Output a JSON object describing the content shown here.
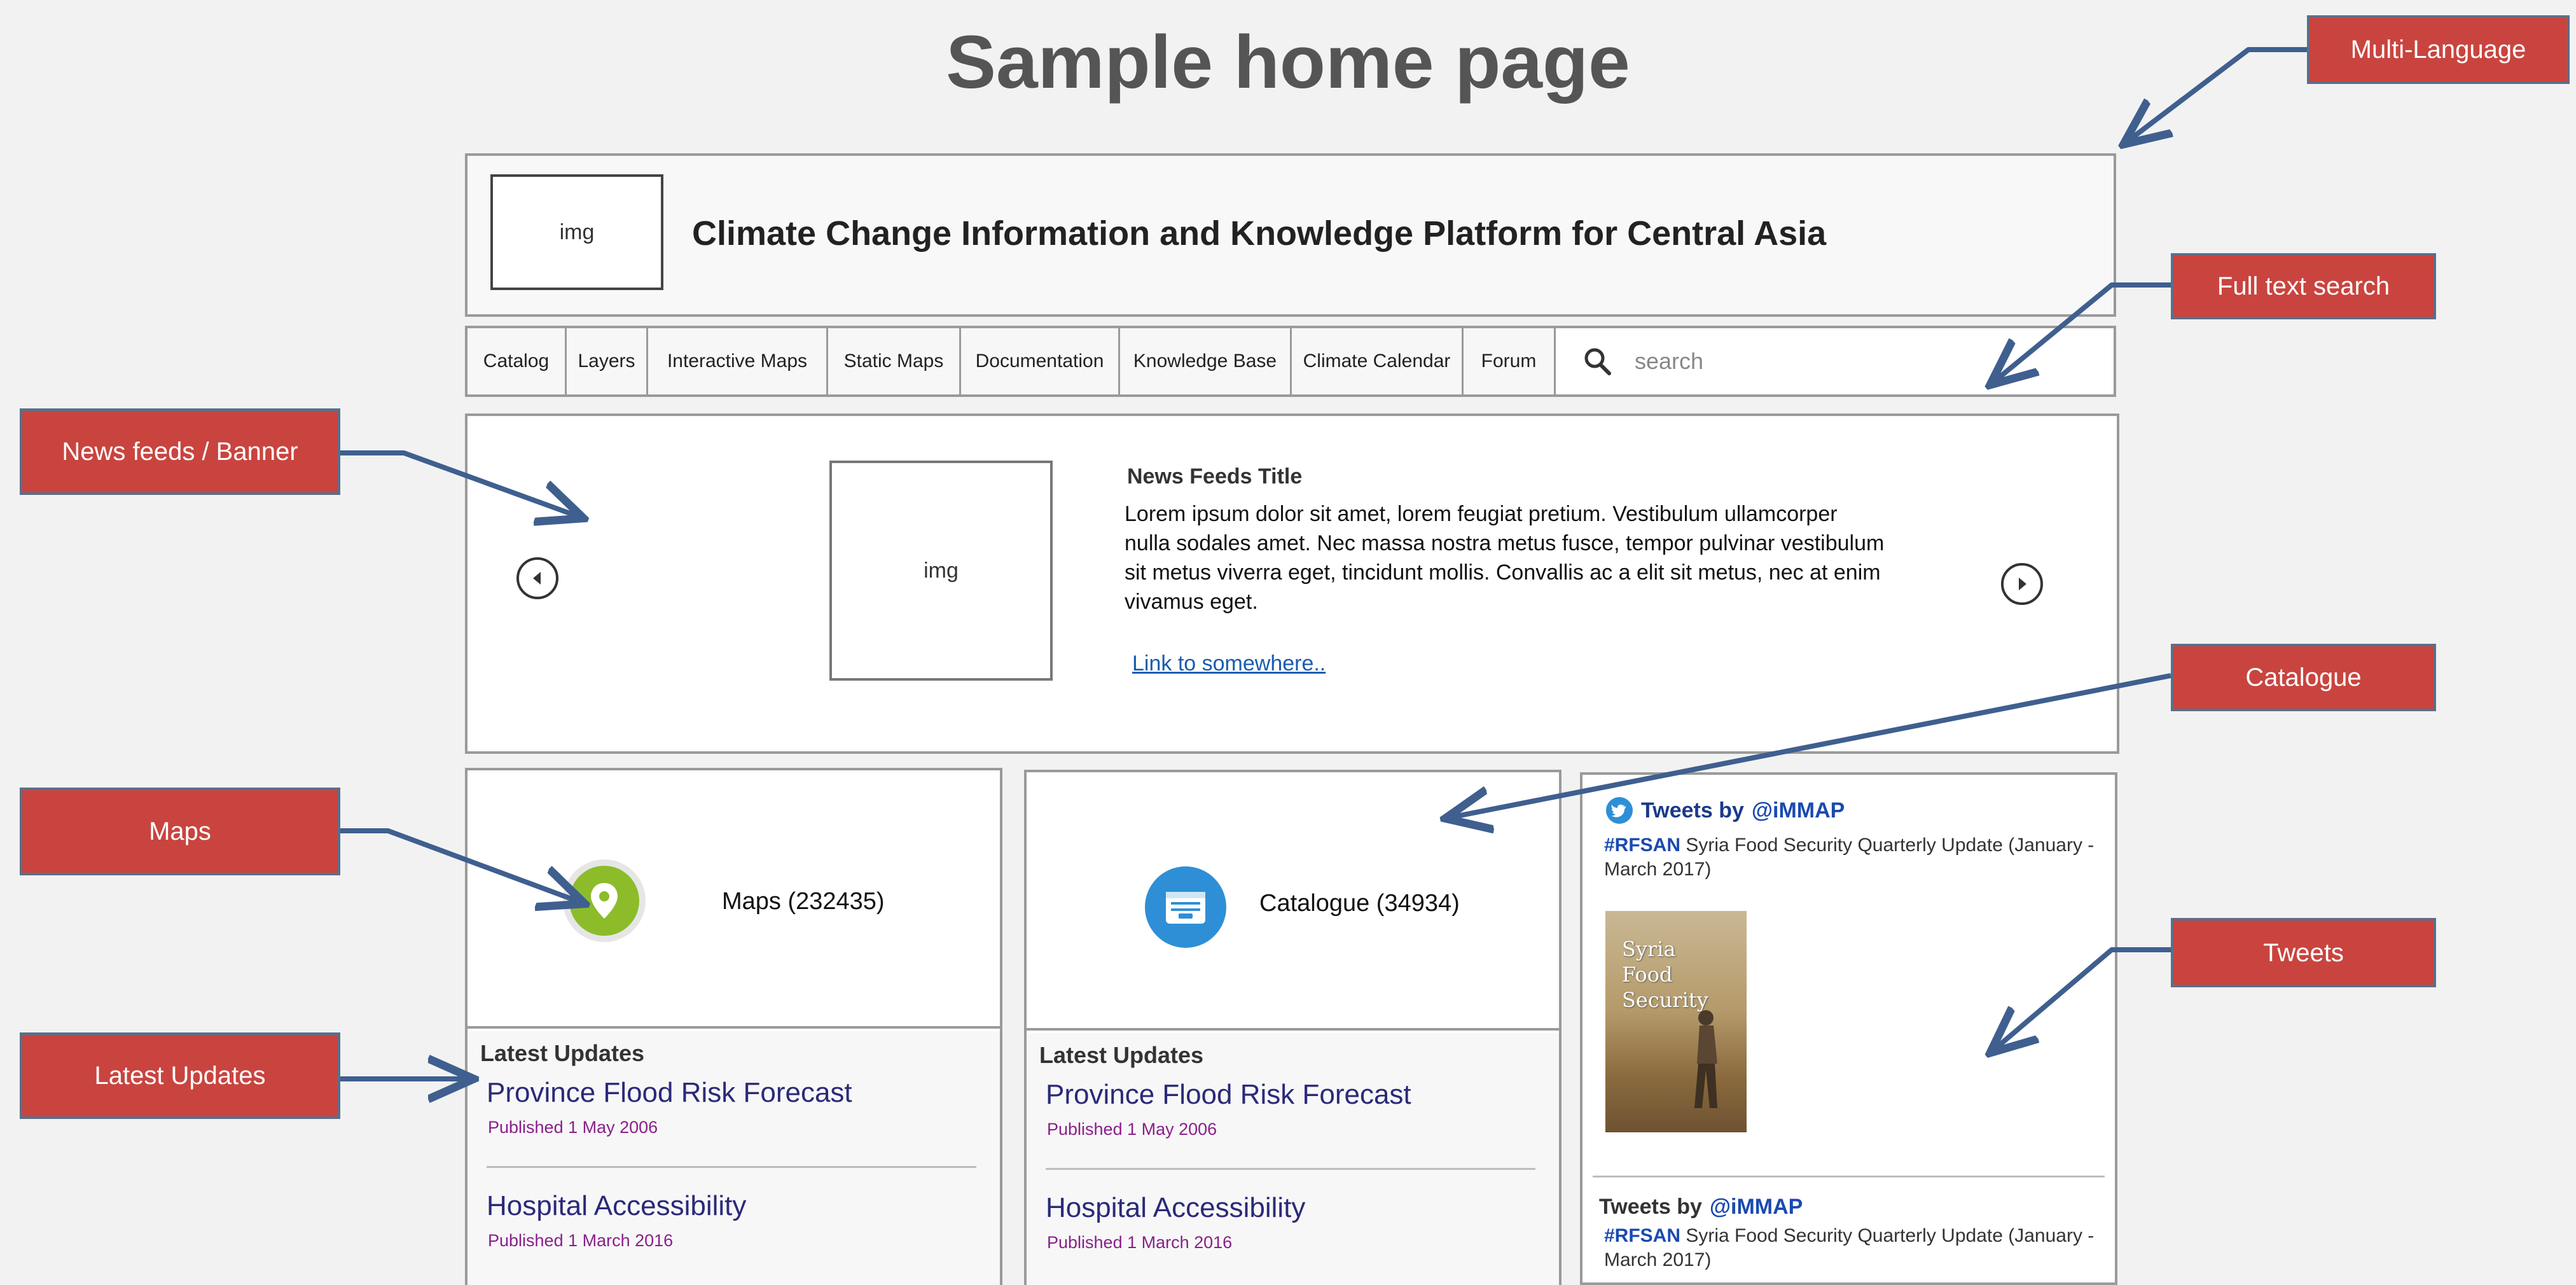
{
  "slide": {
    "title": "Sample home page"
  },
  "header": {
    "logo_placeholder": "img",
    "platform_title": "Climate Change Information and Knowledge Platform for Central Asia"
  },
  "nav": {
    "items": [
      {
        "label": "Catalog"
      },
      {
        "label": "Layers"
      },
      {
        "label": "Interactive Maps"
      },
      {
        "label": "Static Maps"
      },
      {
        "label": "Documentation"
      },
      {
        "label": "Knowledge Base"
      },
      {
        "label": "Climate Calendar"
      },
      {
        "label": "Forum"
      }
    ],
    "search_placeholder": "search",
    "search_icon": "magnifier"
  },
  "banner": {
    "image_placeholder": "img",
    "title": "News Feeds Title",
    "body": "Lorem ipsum dolor sit amet, lorem feugiat pretium. Vestibulum ullamcorper nulla sodales amet. Nec massa nostra metus fusce, tempor pulvinar vestibulum sit metus viverra eget, tincidunt mollis. Convallis ac a elit sit metus, nec at enim vivamus eget.",
    "link": "Link to somewhere..",
    "prev_icon": "chevron-left-circle",
    "next_icon": "chevron-right-circle"
  },
  "maps_card": {
    "icon": "map-pin",
    "icon_color": "#8cbc2a",
    "count_label": "Maps (232435)",
    "latest_heading": "Latest Updates",
    "updates": [
      {
        "title": "Province Flood Risk Forecast",
        "date": "Published 1 May 2006"
      },
      {
        "title": "Hospital Accessibility",
        "date": "Published 1 March 2016"
      }
    ]
  },
  "catalogue_card": {
    "icon": "archive-box",
    "icon_color": "#2e8fd6",
    "count_label": "Catalogue (34934)",
    "latest_heading": "Latest Updates",
    "updates": [
      {
        "title": "Province Flood Risk Forecast",
        "date": "Published 1 May 2006"
      },
      {
        "title": "Hospital Accessibility",
        "date": "Published 1 March 2016"
      }
    ]
  },
  "tweets_card": {
    "tweets": [
      {
        "by_label": "Tweets by",
        "handle": "@iMMAP",
        "hashtag": "#RFSAN",
        "text": "Syria Food Security Quarterly Update (January - March 2017)"
      },
      {
        "by_label": "Tweets by",
        "handle": "@iMMAP",
        "hashtag": "#RFSAN",
        "text": "Syria Food Security Quarterly Update (January - March 2017)"
      }
    ],
    "image_caption_line1": "Syria",
    "image_caption_line2": "Food Security"
  },
  "callouts": {
    "multi_language": "Multi-Language",
    "full_text_search": "Full text search",
    "news_feeds": "News feeds / Banner",
    "catalogue": "Catalogue",
    "maps": "Maps",
    "tweets": "Tweets",
    "latest_updates": "Latest Updates"
  },
  "colors": {
    "callout_fill": "#c9443f",
    "arrow": "#3f5f8f",
    "link": "#1a5cb0",
    "update_title": "#2a2a7a",
    "update_date": "#8a1f8a"
  }
}
